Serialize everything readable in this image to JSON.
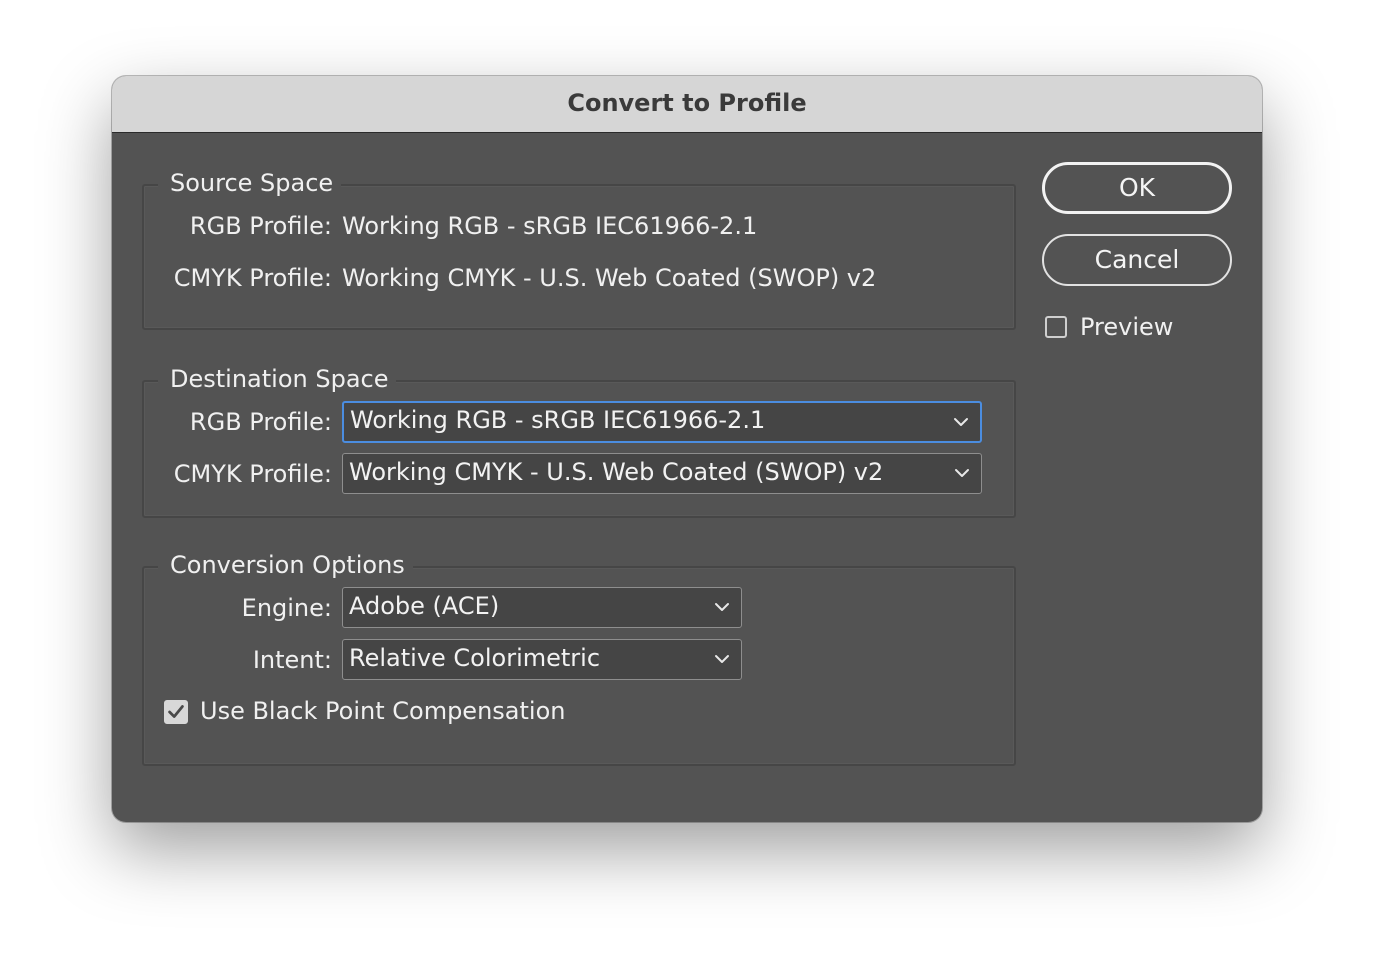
{
  "dialog": {
    "title": "Convert to Profile"
  },
  "source_space": {
    "title": "Source Space",
    "rgb_label": "RGB Profile:",
    "rgb_value": "Working RGB - sRGB IEC61966-2.1",
    "cmyk_label": "CMYK Profile:",
    "cmyk_value": "Working CMYK - U.S. Web Coated (SWOP) v2"
  },
  "destination_space": {
    "title": "Destination Space",
    "rgb_label": "RGB Profile:",
    "rgb_selected": "Working RGB - sRGB IEC61966-2.1",
    "cmyk_label": "CMYK Profile:",
    "cmyk_selected": "Working CMYK - U.S. Web Coated (SWOP) v2"
  },
  "conversion_options": {
    "title": "Conversion Options",
    "engine_label": "Engine:",
    "engine_selected": "Adobe (ACE)",
    "intent_label": "Intent:",
    "intent_selected": "Relative Colorimetric",
    "black_point_label": "Use Black Point Compensation",
    "black_point_checked": true
  },
  "buttons": {
    "ok_label": "OK",
    "cancel_label": "Cancel"
  },
  "preview": {
    "label": "Preview",
    "checked": false
  },
  "colors": {
    "dialog_background": "#535353",
    "titlebar_background": "#d6d6d6",
    "focus_ring": "#4b8de0",
    "text": "#f0f0f0"
  },
  "icons": {
    "dropdown": "chevron-down-icon",
    "checkmark": "checkmark-icon"
  }
}
